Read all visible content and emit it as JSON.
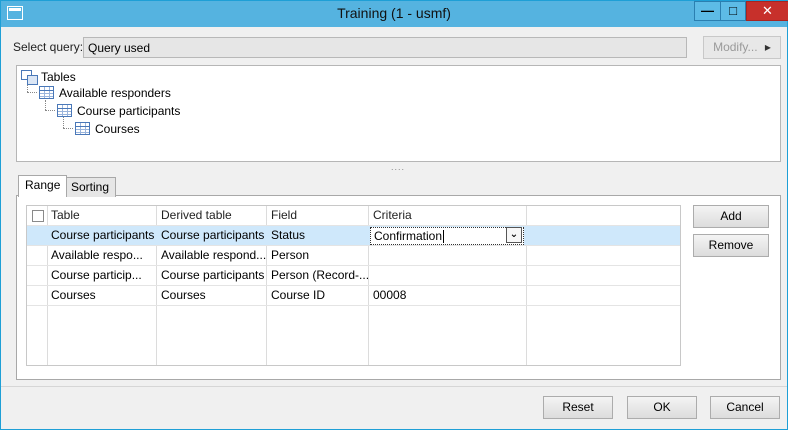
{
  "window": {
    "title": "Training (1 - usmf)",
    "min_glyph": "—",
    "max_glyph": "□",
    "close_glyph": "✕"
  },
  "query": {
    "label": "Select query:",
    "value": "Query used",
    "modify_label": "Modify...",
    "modify_arrow": "▸"
  },
  "tree": {
    "root": "Tables",
    "nodes": [
      "Available responders",
      "Course participants",
      "Courses"
    ]
  },
  "tabs": [
    {
      "label": "Range",
      "active": true
    },
    {
      "label": "Sorting",
      "active": false
    }
  ],
  "grid": {
    "columns": [
      "Table",
      "Derived table",
      "Field",
      "Criteria"
    ],
    "rows": [
      {
        "table": "Course participants",
        "derived": "Course participants",
        "field": "Status",
        "criteria": "Confirmation",
        "selected": true
      },
      {
        "table": "Available respo...",
        "derived": "Available respond...",
        "field": "Person",
        "criteria": ""
      },
      {
        "table": "Course particip...",
        "derived": "Course participants",
        "field": "Person (Record-...",
        "criteria": ""
      },
      {
        "table": "Courses",
        "derived": "Courses",
        "field": "Course ID",
        "criteria": "00008"
      }
    ],
    "dropdown_glyph": "⌄"
  },
  "side_buttons": {
    "add": "Add",
    "remove": "Remove"
  },
  "footer": {
    "reset": "Reset",
    "ok": "OK",
    "cancel": "Cancel"
  },
  "colors": {
    "titlebar": "#55b3e0",
    "close": "#c7302b",
    "selection": "#cfe8fb"
  }
}
